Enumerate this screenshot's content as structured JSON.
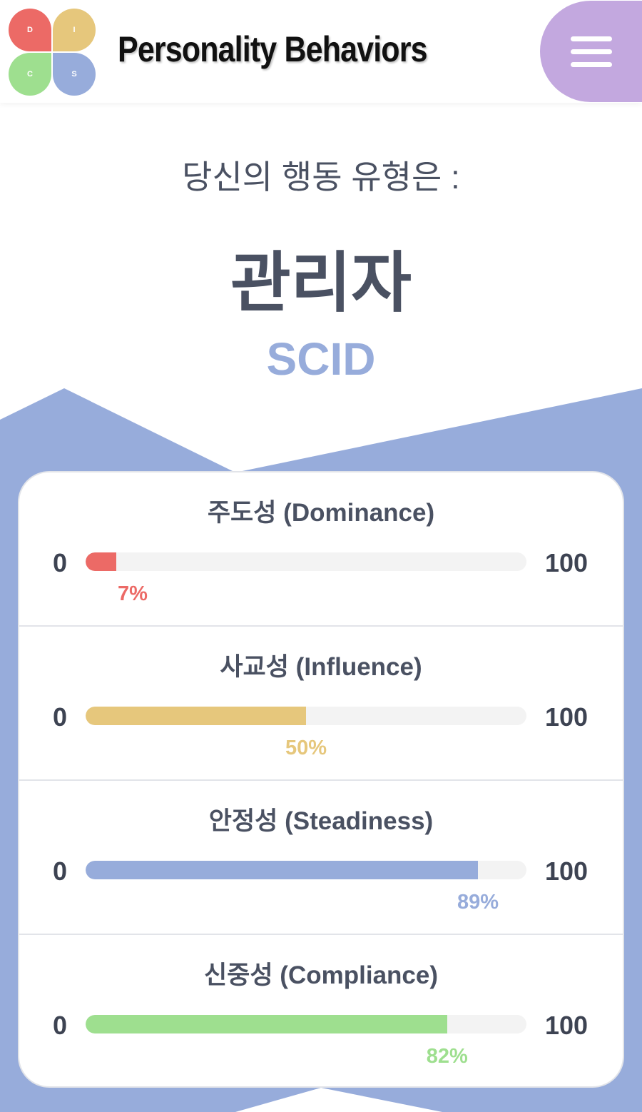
{
  "header": {
    "app_title": "Personality Behaviors",
    "logo_letters": [
      "D",
      "I",
      "C",
      "S"
    ],
    "menu_icon": "hamburger-menu-icon"
  },
  "result": {
    "subtitle": "당신의 행동 유형은 :",
    "type_name": "관리자",
    "type_code": "SCID"
  },
  "traits": [
    {
      "title": "주도성 (Dominance)",
      "min": "0",
      "max": "100",
      "percent": 7,
      "label": "7%",
      "color": "#ec6a66"
    },
    {
      "title": "사교성 (Influence)",
      "min": "0",
      "max": "100",
      "percent": 50,
      "label": "50%",
      "color": "#e6c77c"
    },
    {
      "title": "안정성 (Steadiness)",
      "min": "0",
      "max": "100",
      "percent": 89,
      "label": "89%",
      "color": "#97acdb"
    },
    {
      "title": "신중성 (Compliance)",
      "min": "0",
      "max": "100",
      "percent": 82,
      "label": "82%",
      "color": "#9edf8f"
    }
  ],
  "colors": {
    "accent_blue": "#97acdb",
    "menu_purple": "#c3a8df",
    "text_dark": "#4a5162"
  }
}
